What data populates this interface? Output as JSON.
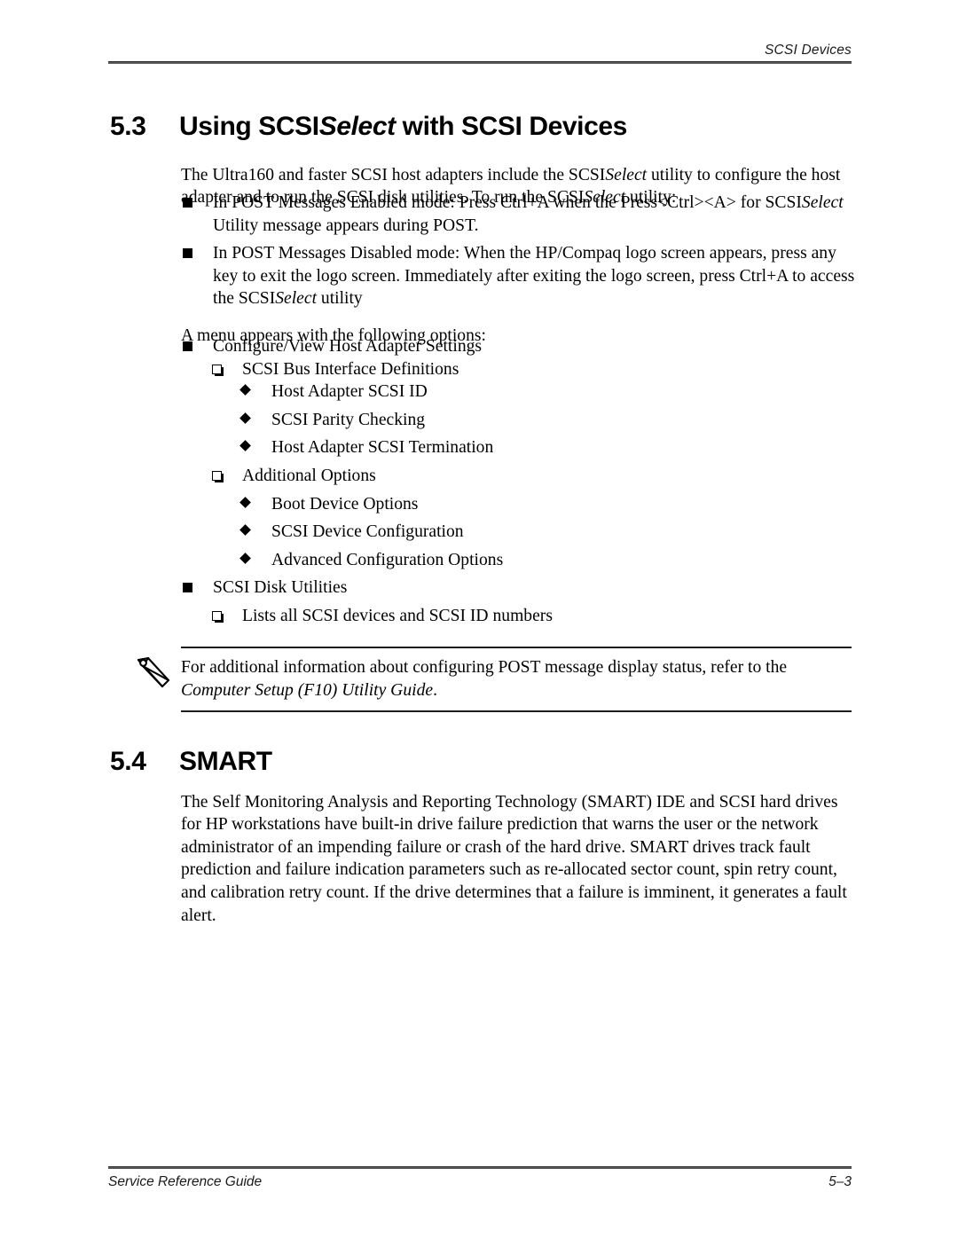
{
  "header": {
    "running_title": "SCSI Devices"
  },
  "sections": {
    "scsiselect": {
      "number": "5.3",
      "title_part1": "Using SCSI",
      "title_italic": "Select",
      "title_part2": " with SCSI Devices",
      "intro_paragraph": "The Ultra160 and faster SCSI host adapters include the SCSISelect utility to configure the host adapter and to run the SCSI disk utilities. To run the SCSISelect utility:",
      "run_steps": [
        "In POST Messages Enabled mode: Press Ctrl+A when the Press<Ctrl><A> for SCSISelect Utility message appears during POST.",
        "In POST Messages Disabled mode: When the HP/Compaq logo screen appears, press any key to exit the logo screen. Immediately after exiting the logo screen, press Ctrl+A to access the SCSISelect utility"
      ],
      "menu_lead_in": "A menu appears with the following options:",
      "menu_items": [
        {
          "level": 1,
          "marker": "filled-square-bullet",
          "text": "Configure/View Host Adapter Settings"
        },
        {
          "level": 2,
          "marker": "hollow-square-bullet",
          "text": "SCSI Bus Interface Definitions"
        },
        {
          "level": 3,
          "marker": "diamond-bullet",
          "text": "Host Adapter SCSI ID"
        },
        {
          "level": 3,
          "marker": "diamond-bullet",
          "text": "SCSI Parity Checking"
        },
        {
          "level": 3,
          "marker": "diamond-bullet",
          "text": "Host Adapter SCSI Termination"
        },
        {
          "level": 2,
          "marker": "hollow-square-bullet",
          "text": "Additional Options"
        },
        {
          "level": 3,
          "marker": "diamond-bullet",
          "text": "Boot Device Options"
        },
        {
          "level": 3,
          "marker": "diamond-bullet",
          "text": "SCSI Device Configuration"
        },
        {
          "level": 3,
          "marker": "diamond-bullet",
          "text": "Advanced Configuration Options"
        },
        {
          "level": 1,
          "marker": "filled-square-bullet",
          "text": "SCSI Disk Utilities"
        },
        {
          "level": 2,
          "marker": "hollow-square-bullet",
          "text": "Lists all SCSI devices and SCSI ID numbers"
        }
      ],
      "note": {
        "icon": "pencil-note-icon",
        "line1": "For additional information about configuring POST message display status, refer to the",
        "reference_italic": "Computer Setup (F10) Utility Guide",
        "trailing": "."
      }
    },
    "smart": {
      "number": "5.4",
      "title": "SMART",
      "paragraph": "The Self Monitoring Analysis and Reporting Technology (SMART) IDE and SCSI hard drives for HP workstations have built-in drive failure prediction that warns the user or the network administrator of an impending failure or crash of the hard drive. SMART drives track fault prediction and failure indication parameters such as re-allocated sector count, spin retry count, and calibration retry count. If the drive determines that a failure is imminent, it generates a fault alert."
    }
  },
  "footer": {
    "document_title": "Service Reference Guide",
    "page_number": "5–3"
  },
  "colors": {
    "text": "#000000",
    "rule": "#5a5a5a",
    "page_background": "#ffffff"
  }
}
